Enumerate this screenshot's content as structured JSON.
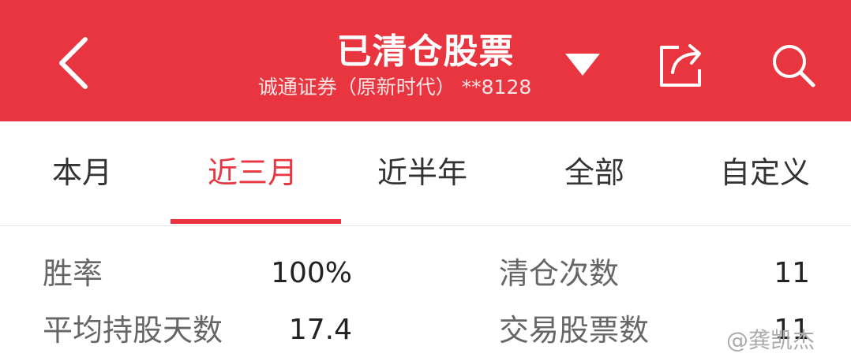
{
  "header": {
    "title": "已清仓股票",
    "subtitle": "诚通证券（原新时代） **8128",
    "background_color": "#e8353f",
    "icons": [
      "back-arrow-icon",
      "dropdown-triangle-icon",
      "share-icon",
      "search-icon"
    ]
  },
  "tabs": [
    {
      "label": "本月",
      "active": false
    },
    {
      "label": "近三月",
      "active": true
    },
    {
      "label": "近半年",
      "active": false
    },
    {
      "label": "全部",
      "active": false
    },
    {
      "label": "自定义",
      "active": false
    }
  ],
  "stats": {
    "win_rate": {
      "label": "胜率",
      "value": "100%"
    },
    "clear_count": {
      "label": "清仓次数",
      "value": "11"
    },
    "avg_hold_days": {
      "label": "平均持股天数",
      "value": "17.4"
    },
    "traded_stocks": {
      "label": "交易股票数",
      "value": "11"
    }
  },
  "watermark": "@龚凯杰",
  "accent_color": "#e8353f"
}
